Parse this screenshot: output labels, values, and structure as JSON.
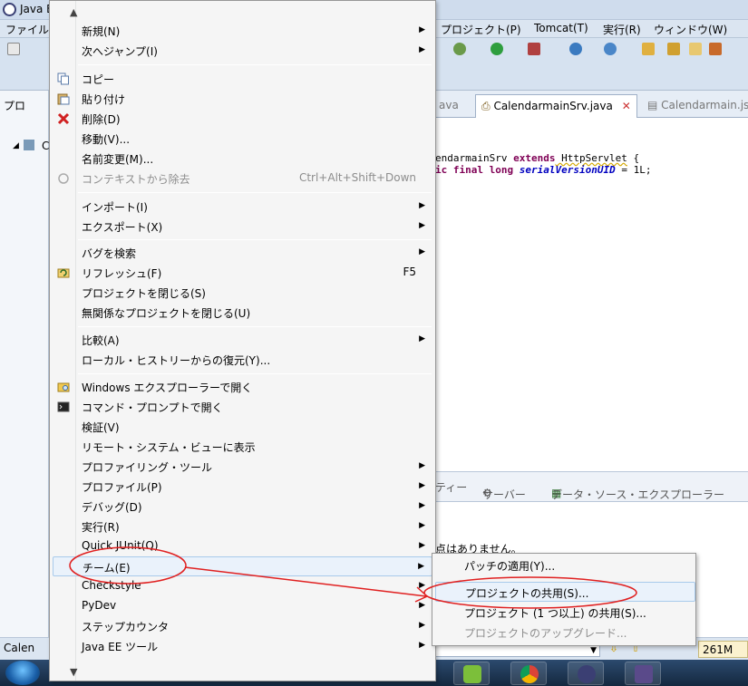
{
  "window": {
    "title": "Java E",
    "menubar": [
      {
        "label": "ファイル"
      },
      {
        "label": "プロジェクト(P)"
      },
      {
        "label": "Tomcat(T)"
      },
      {
        "label": "実行(R)"
      },
      {
        "label": "ウィンドウ(W)"
      }
    ]
  },
  "editor_tabs": [
    {
      "label": "ava"
    },
    {
      "label": "CalendarmainSrv.java",
      "active": true
    },
    {
      "label": "Calendarmain.jsp"
    }
  ],
  "left_panel": {
    "tab_label": "プロ",
    "tree_label": "C"
  },
  "code": {
    "line1": {
      "a": "endarmainSrv ",
      "b": "extends",
      "c": " HttpServlet",
      "d": " {"
    },
    "line2": {
      "a": "ic ",
      "b": "final long",
      "c": " ",
      "d": "serialVersionUID",
      "e": " = 1L;"
    }
  },
  "lower_tabs": [
    {
      "label": "ティー"
    },
    {
      "label": "サーバー"
    },
    {
      "label": "データ・ソース・エクスプローラー"
    }
  ],
  "info_text": "点はありません。",
  "status": {
    "left": "Calen",
    "memory": "261M"
  },
  "context_menu": {
    "items": [
      {
        "label": "新規(N)",
        "submenu": true
      },
      {
        "label": "次へジャンプ(I)",
        "submenu": true
      },
      {
        "label": "コピー",
        "icon": "copy-icon"
      },
      {
        "label": "貼り付け",
        "icon": "paste-icon"
      },
      {
        "label": "削除(D)",
        "icon": "delete-icon"
      },
      {
        "label": "移動(V)..."
      },
      {
        "label": "名前変更(M)..."
      },
      {
        "label": "コンテキストから除去",
        "accel": "Ctrl+Alt+Shift+Down",
        "disabled": true,
        "icon": "remove-context-icon"
      },
      {
        "label": "インポート(I)",
        "submenu": true
      },
      {
        "label": "エクスポート(X)",
        "submenu": true
      },
      {
        "label": "バグを検索",
        "submenu": true
      },
      {
        "label": "リフレッシュ(F)",
        "accel": "F5",
        "icon": "refresh-icon"
      },
      {
        "label": "プロジェクトを閉じる(S)"
      },
      {
        "label": "無関係なプロジェクトを閉じる(U)"
      },
      {
        "label": "比較(A)",
        "submenu": true
      },
      {
        "label": "ローカル・ヒストリーからの復元(Y)..."
      },
      {
        "label": "Windows エクスプローラーで開く",
        "icon": "folder-explore-icon"
      },
      {
        "label": "コマンド・プロンプトで開く",
        "icon": "terminal-icon"
      },
      {
        "label": "検証(V)"
      },
      {
        "label": "リモート・システム・ビューに表示"
      },
      {
        "label": "プロファイリング・ツール",
        "submenu": true
      },
      {
        "label": "プロファイル(P)",
        "submenu": true
      },
      {
        "label": "デバッグ(D)",
        "submenu": true
      },
      {
        "label": "実行(R)",
        "submenu": true
      },
      {
        "label": "Quick JUnit(Q)",
        "submenu": true
      },
      {
        "label": "チーム(E)",
        "submenu": true,
        "highlighted": true
      },
      {
        "label": "Checkstyle",
        "submenu": true
      },
      {
        "label": "PyDev",
        "submenu": true
      },
      {
        "label": "ステップカウンタ",
        "submenu": true
      },
      {
        "label": "Java EE ツール",
        "submenu": true
      }
    ]
  },
  "team_submenu": {
    "items": [
      {
        "label": "パッチの適用(Y)..."
      },
      {
        "label": "プロジェクトの共用(S)...",
        "highlighted": true
      },
      {
        "label": "プロジェクト (1 つ以上) の共用(S)..."
      },
      {
        "label": "プロジェクトのアップグレード...",
        "disabled": true
      }
    ]
  },
  "colors": {
    "annotation": "#e02020",
    "menu_highlight": "#eaf2fb",
    "highlight_border": "#a8caeb"
  }
}
